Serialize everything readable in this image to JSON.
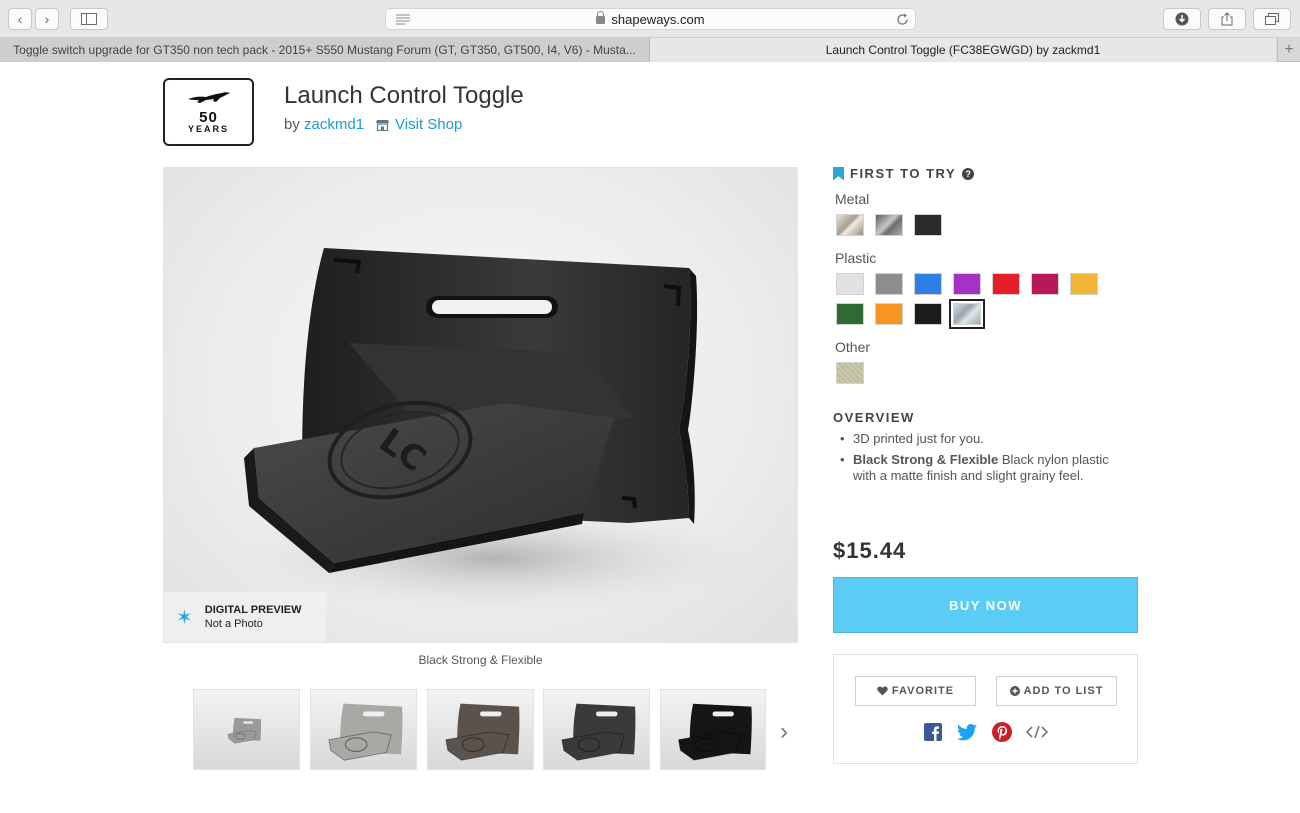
{
  "browser": {
    "url": "shapeways.com",
    "tabs": [
      {
        "label": "Toggle switch upgrade for GT350 non tech pack - 2015+ S550 Mustang Forum (GT, GT350, GT500, I4, V6) - Musta..."
      },
      {
        "label": "Launch Control Toggle (FC38EGWGD) by zackmd1"
      }
    ],
    "new_tab": "+"
  },
  "header": {
    "logo": {
      "line1": "50",
      "line2": "YEARS",
      "icon": "mustang-horse-icon"
    },
    "title": "Launch Control Toggle",
    "by": "by",
    "author": "zackmd1",
    "visit_shop": "Visit Shop"
  },
  "preview": {
    "badge_title": "DIGITAL PREVIEW",
    "badge_subtitle": "Not a Photo",
    "caption": "Black Strong & Flexible",
    "product_text": "LC"
  },
  "thumbnails": [
    {
      "color": "#9a9a9a",
      "variant": "small-grey"
    },
    {
      "color": "#a8a8a4",
      "variant": "light-grey"
    },
    {
      "color": "#5a524c",
      "variant": "bronze"
    },
    {
      "color": "#3a3a3a",
      "variant": "dark"
    },
    {
      "color": "#151515",
      "variant": "black"
    }
  ],
  "sidebar": {
    "first_to_try": "FIRST TO TRY",
    "help": "?",
    "materials": [
      {
        "label": "Metal",
        "swatches": [
          "#b9b2a9",
          "#8c8c8c",
          "#2b2b2b"
        ]
      },
      {
        "label": "Plastic",
        "swatches": [
          "#e2e2e2",
          "#8e8e8e",
          "#2f7ee8",
          "#a532c7",
          "#e51e2a",
          "#b8175a",
          "#f2b637",
          "#2f6a34",
          "#f5961f",
          "#1c1c1c",
          "#b8c2c8"
        ]
      },
      {
        "label": "Other",
        "swatches": [
          "#c6c6a8"
        ]
      }
    ],
    "selected_swatch": "Plastic-10",
    "overview_title": "OVERVIEW",
    "overview": [
      {
        "bold": "",
        "text": "3D printed just for you."
      },
      {
        "bold": "Black Strong & Flexible",
        "text": " Black nylon plastic with a matte finish and slight grainy feel."
      }
    ],
    "price": "$15.44",
    "buy_label": "BUY NOW",
    "favorite_label": "FAVORITE",
    "add_to_list_label": "ADD TO LIST",
    "social": [
      "facebook-icon",
      "twitter-icon",
      "pinterest-icon",
      "embed-code-icon"
    ]
  },
  "colors": {
    "accent": "#1a9bd7",
    "buy": "#5bcdf5",
    "bookmark": "#2aa6d8"
  }
}
